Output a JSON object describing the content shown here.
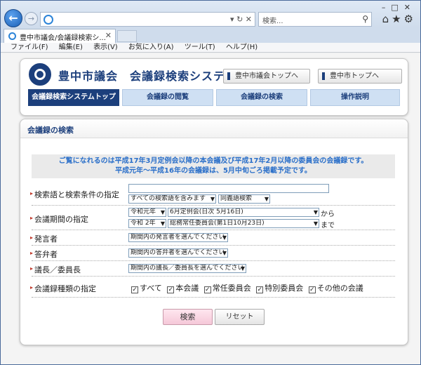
{
  "browser": {
    "search_placeholder": "検索...",
    "tab_title": "豊中市議会/会議録検索シ...",
    "menu": [
      "ファイル(F)",
      "編集(E)",
      "表示(V)",
      "お気に入り(A)",
      "ツール(T)",
      "ヘルプ(H)"
    ]
  },
  "header": {
    "site_title": "豊中市議会　会議録検索システム",
    "btn_council_top": "豊中市議会トップへ",
    "btn_city_top": "豊中市トップへ"
  },
  "nav": [
    "会議録検索システムトップ",
    "会議録の閲覧",
    "会議録の検索",
    "操作説明"
  ],
  "content": {
    "heading": "会議録の検索",
    "notice_line1": "ご覧になれるのは平成17年3月定例会以降の本会議及び平成17年2月以降の委員会の会議録です。",
    "notice_line2": "平成元年～平成16年の会議録は、5月中旬ごろ掲載予定です。"
  },
  "form": {
    "keyword_label": "検索語と検索条件の指定",
    "keyword_value": "",
    "keyword_mode": "すべての検索語を含みます",
    "synonym_mode": "同義語検索",
    "period_label": "会議期間の指定",
    "period_from_era": "令和元年",
    "period_from_session": "6月定例会(日次 5月16日)",
    "period_from_suffix": "から",
    "period_to_era": "令和 2年",
    "period_to_session": "総務常任委員会(第1日10月23日)",
    "period_to_suffix": "まで",
    "speaker_label": "発言者",
    "speaker_value": "期間内の発言者を選んでください",
    "answerer_label": "答弁者",
    "answerer_value": "期間内の答弁者を選んでください",
    "chair_label": "議長／委員長",
    "chair_value": "期間内の議長／委員長を選んでください",
    "type_label": "会議録種類の指定",
    "types": [
      "すべて",
      "本会議",
      "常任委員会",
      "特別委員会",
      "その他の会議"
    ],
    "search_button": "検索",
    "reset_button": "リセット"
  }
}
